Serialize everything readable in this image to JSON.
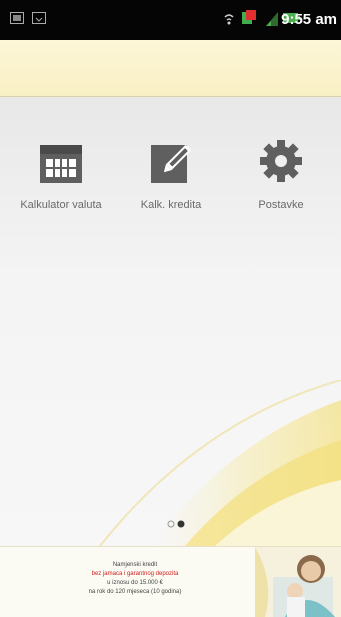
{
  "status_bar": {
    "time": "9:55 am",
    "icons": [
      "image-icon",
      "download-icon",
      "wifi-icon",
      "notification-icon",
      "signal-icon",
      "battery-icon"
    ]
  },
  "menu": {
    "items": [
      {
        "label": "Kalkulator valuta",
        "icon": "calendar-grid-icon"
      },
      {
        "label": "Kalk. kredita",
        "icon": "edit-pencil-icon"
      },
      {
        "label": "Postavke",
        "icon": "gear-icon"
      }
    ]
  },
  "pager": {
    "pages": 2,
    "current": 2
  },
  "ad": {
    "line1": "Namjenski kredit",
    "line2": "bez jamaca i garantnog depozita",
    "line3": "u iznosu do 15.000 €",
    "line4": "na rok do 120 mjeseca (10 godina)"
  },
  "colors": {
    "status_bar": "#050505",
    "header_band": "#fbf3cf",
    "icon_dark": "#5f5f5f",
    "label_gray": "#6a6a6a",
    "ad_accent": "#d02020",
    "swoosh_yellow": "#f6e27a"
  }
}
